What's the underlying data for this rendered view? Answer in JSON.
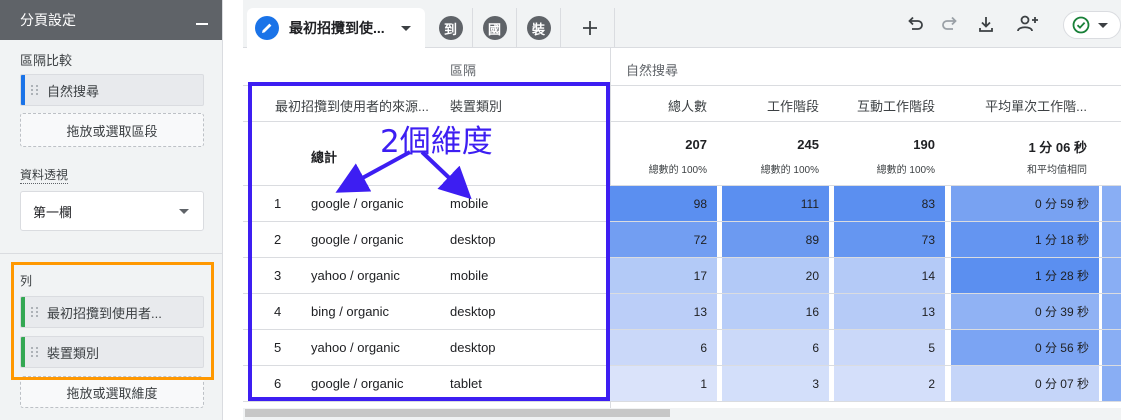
{
  "sidebar": {
    "header": "分頁設定",
    "segment_compare_label": "區隔比較",
    "segment_chip": "自然搜尋",
    "segment_drop": "拖放或選取區段",
    "pivot_label": "資料透視",
    "pivot_value": "第一欄",
    "rows_label": "列",
    "row_chips": [
      "最初招攬到使用者...",
      "裝置類別"
    ],
    "rows_drop": "拖放或選取維度"
  },
  "toolbar": {
    "active_tab": "最初招攬到使...",
    "tabs": [
      "到",
      "國",
      "裝"
    ],
    "add_tab": "+"
  },
  "table": {
    "group_dimension_header": "區隔",
    "group_metric_header": "自然搜尋",
    "dim_headers": [
      "最初招攬到使用者的來源...",
      "裝置類別"
    ],
    "metric_headers": [
      "總人數",
      "工作階段",
      "互動工作階段",
      "平均單次工作階..."
    ],
    "total_label": "總計",
    "totals": [
      {
        "value": "207",
        "sub": "總數的 100%"
      },
      {
        "value": "245",
        "sub": "總數的 100%"
      },
      {
        "value": "190",
        "sub": "總數的 100%"
      },
      {
        "value": "1 分 06 秒",
        "sub": "和平均值相同"
      }
    ],
    "rows": [
      {
        "n": "1",
        "source": "google / organic",
        "device": "mobile",
        "users": "98",
        "sessions": "111",
        "engaged": "83",
        "avg": "0 分 59 秒"
      },
      {
        "n": "2",
        "source": "google / organic",
        "device": "desktop",
        "users": "72",
        "sessions": "89",
        "engaged": "73",
        "avg": "1 分 18 秒"
      },
      {
        "n": "3",
        "source": "yahoo / organic",
        "device": "mobile",
        "users": "17",
        "sessions": "20",
        "engaged": "14",
        "avg": "1 分 28 秒"
      },
      {
        "n": "4",
        "source": "bing / organic",
        "device": "desktop",
        "users": "13",
        "sessions": "16",
        "engaged": "13",
        "avg": "0 分 39 秒"
      },
      {
        "n": "5",
        "source": "yahoo / organic",
        "device": "desktop",
        "users": "6",
        "sessions": "6",
        "engaged": "5",
        "avg": "0 分 56 秒"
      },
      {
        "n": "6",
        "source": "google / organic",
        "device": "tablet",
        "users": "1",
        "sessions": "3",
        "engaged": "2",
        "avg": "0 分 07 秒"
      }
    ]
  },
  "annotation": {
    "text": "2個維度",
    "color": "#3d1ef2"
  },
  "colors": {
    "accent": "#1a73e8",
    "highlight_orange": "#ff9800",
    "heat_max": "#5b8ff0",
    "heat_min": "#e3e9fb"
  }
}
